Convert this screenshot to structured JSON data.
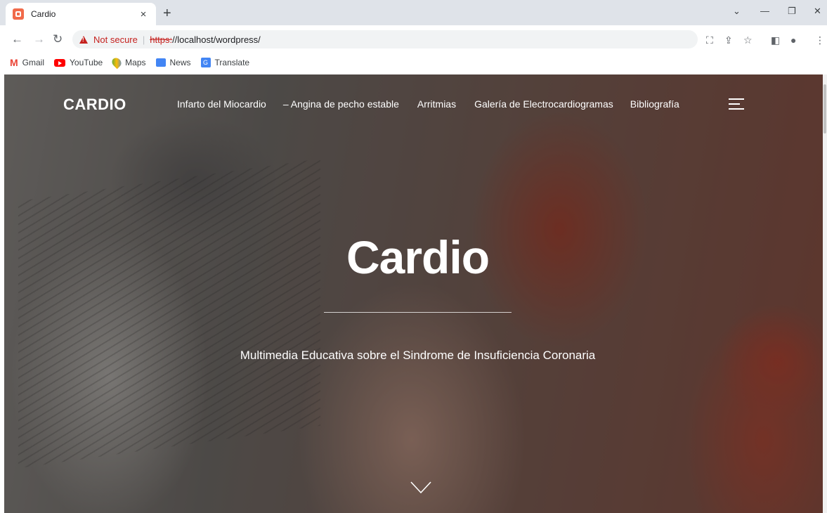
{
  "browser": {
    "tab": {
      "title": "Cardio"
    },
    "new_tab_label": "+",
    "address": {
      "security_label": "Not secure",
      "url_scheme": "https:",
      "url_rest": "//localhost/wordpress/"
    },
    "bookmarks": [
      {
        "label": "Gmail",
        "icon": "gmail-icon"
      },
      {
        "label": "YouTube",
        "icon": "youtube-icon"
      },
      {
        "label": "Maps",
        "icon": "maps-icon"
      },
      {
        "label": "News",
        "icon": "news-icon"
      },
      {
        "label": "Translate",
        "icon": "translate-icon"
      }
    ]
  },
  "site": {
    "logo": "CARDIO",
    "nav": [
      "Infarto del Miocardio",
      "– Angina de pecho estable",
      "Arritmias",
      "Galería de Electrocardiogramas",
      "Bibliografía"
    ],
    "hero": {
      "title": "Cardio",
      "subtitle": "Multimedia Educativa sobre el Sindrome de Insuficiencia Coronaria"
    }
  }
}
